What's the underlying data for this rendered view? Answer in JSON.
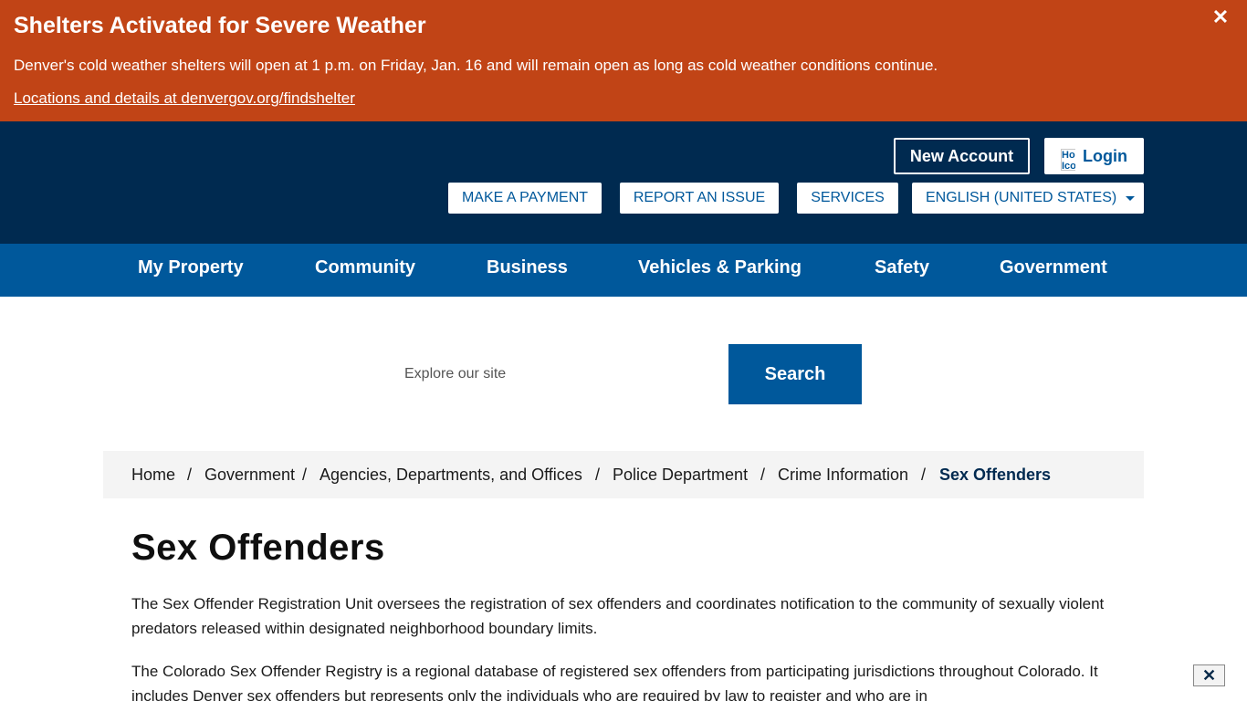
{
  "alert": {
    "title": "Shelters Activated for Severe Weather",
    "text": "Denver's cold weather shelters will open at 1 p.m. on Friday, Jan. 16 and will remain open as long as cold weather conditions continue.",
    "link": "Locations and details at denvergov.org/findshelter",
    "close_icon": "✕"
  },
  "header": {
    "new_account": "New Account",
    "login": "Login",
    "login_icon_alt": "Home Icon",
    "utility": {
      "payment": "MAKE A PAYMENT",
      "report": "REPORT AN ISSUE",
      "services": "SERVICES",
      "language": "ENGLISH (UNITED STATES)"
    }
  },
  "nav": {
    "items": [
      "My Property",
      "Community",
      "Business",
      "Vehicles & Parking",
      "Safety",
      "Government"
    ]
  },
  "search": {
    "placeholder": "Explore our site",
    "button": "Search"
  },
  "breadcrumb": {
    "items": [
      "Home",
      "Government",
      "Agencies, Departments, and Offices",
      "Police Department",
      "Crime Information"
    ],
    "current": "Sex Offenders",
    "separator": "/"
  },
  "content": {
    "title": "Sex Offenders",
    "paragraphs": [
      "The Sex Offender Registration Unit oversees the registration of sex offenders and coordinates notification to the community of sexually violent predators released within designated neighborhood boundary limits.",
      "The Colorado Sex Offender Registry is a regional database of registered sex offenders from participating jurisdictions throughout Colorado. It includes Denver sex offenders but represents only the individuals who are required by law to register and who are in"
    ]
  },
  "float_close_icon": "✕",
  "colors": {
    "alert_bg": "#c14416",
    "header_bg": "#002a50",
    "nav_bg": "#00589b",
    "breadcrumb_bg": "#f4f4f4"
  }
}
